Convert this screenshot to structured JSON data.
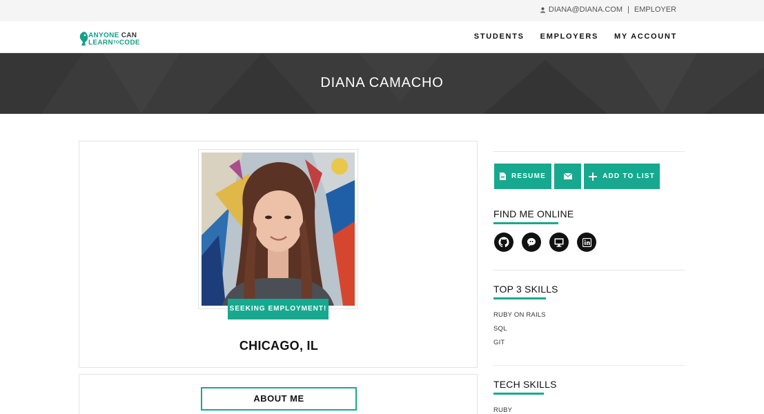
{
  "topbar": {
    "user_email": "DIANA@DIANA.COM",
    "separator": "|",
    "role": "EMPLOYER"
  },
  "logo": {
    "line1_main": "ANYONE",
    "line1_accent": "CAN",
    "line2_main": "LEARN",
    "line2_small": "TO",
    "line2_end": "CODE"
  },
  "nav": {
    "students": "STUDENTS",
    "employers": "EMPLOYERS",
    "account": "MY ACCOUNT"
  },
  "hero": {
    "name": "DIANA CAMACHO"
  },
  "profile": {
    "status_badge": "SEEKING EMPLOYMENT!",
    "location": "CHICAGO, IL"
  },
  "about": {
    "button_label": "ABOUT ME"
  },
  "actions": {
    "resume_label": "RESUME",
    "add_to_list_label": "ADD TO LIST"
  },
  "find_me": {
    "title": "FIND ME ONLINE",
    "icons": [
      "github-icon",
      "chat-bubble-icon",
      "monitor-icon",
      "linkedin-icon"
    ]
  },
  "top_skills": {
    "title": "TOP 3 SKILLS",
    "items": [
      "RUBY ON RAILS",
      "SQL",
      "GIT"
    ]
  },
  "tech_skills": {
    "title": "TECH SKILLS",
    "items": [
      "RUBY"
    ]
  },
  "colors": {
    "accent": "#16a98f",
    "hero_bg": "#3b3b3b",
    "topbar_bg": "#f5f5f5"
  }
}
